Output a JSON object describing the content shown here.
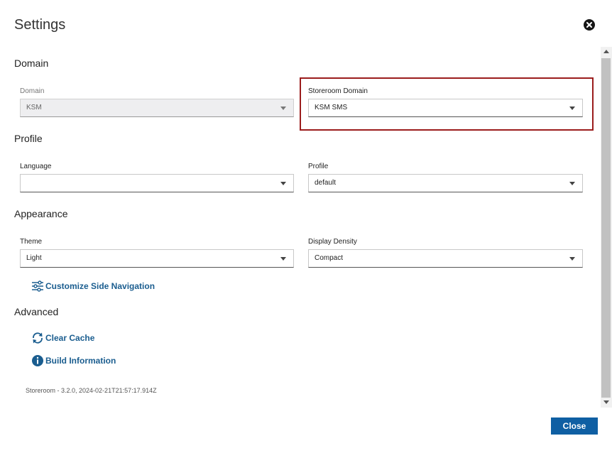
{
  "dialog": {
    "title": "Settings"
  },
  "sections": {
    "domain": {
      "heading": "Domain",
      "domain_field": {
        "label": "Domain",
        "value": "KSM",
        "disabled": true
      },
      "storeroom_field": {
        "label": "Storeroom Domain",
        "value": "KSM SMS"
      }
    },
    "profile": {
      "heading": "Profile",
      "language_field": {
        "label": "Language",
        "value": ""
      },
      "profile_field": {
        "label": "Profile",
        "value": "default"
      }
    },
    "appearance": {
      "heading": "Appearance",
      "theme_field": {
        "label": "Theme",
        "value": "Light"
      },
      "density_field": {
        "label": "Display Density",
        "value": "Compact"
      },
      "customize_link": "Customize Side Navigation"
    },
    "advanced": {
      "heading": "Advanced",
      "clear_cache_link": "Clear Cache",
      "build_info_link": "Build Information"
    }
  },
  "build_string": "Storeroom - 3.2.0, 2024-02-21T21:57:17.914Z",
  "footer": {
    "close_label": "Close"
  },
  "colors": {
    "highlight_border": "#9b1c1c",
    "link": "#1a5d8f",
    "primary_button": "#0f5fa3"
  },
  "icons": {
    "close": "close-circle-icon",
    "customize": "sliders-icon",
    "clear_cache": "refresh-icon",
    "build_info": "info-icon"
  }
}
